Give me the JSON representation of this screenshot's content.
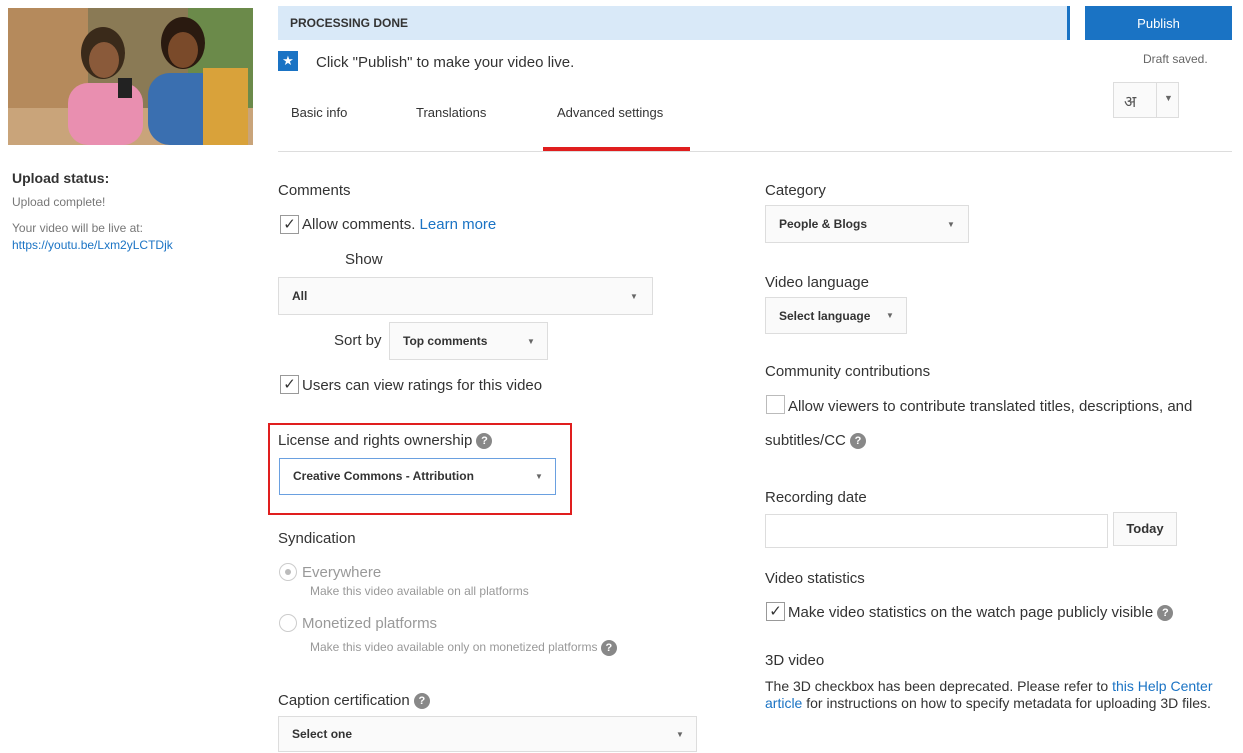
{
  "sidebar": {
    "status_title": "Upload status:",
    "status_text": "Upload complete!",
    "live_text": "Your video will be live at:",
    "video_link": "https://youtu.be/Lxm2yLCTDjk"
  },
  "header": {
    "processing": "PROCESSING DONE",
    "publish_label": "Publish",
    "draft_saved": "Draft saved.",
    "publish_hint": "Click \"Publish\" to make your video live.",
    "lang_glyph": "अ"
  },
  "tabs": [
    {
      "label": "Basic info"
    },
    {
      "label": "Translations"
    },
    {
      "label": "Advanced settings",
      "active": true
    }
  ],
  "comments": {
    "heading": "Comments",
    "allow_label": "Allow comments.",
    "learn_more": "Learn more",
    "show_label": "Show",
    "show_value": "All",
    "sort_label": "Sort by",
    "sort_value": "Top comments",
    "ratings_label": "Users can view ratings for this video"
  },
  "license": {
    "heading": "License and rights ownership",
    "value": "Creative Commons - Attribution"
  },
  "syndication": {
    "heading": "Syndication",
    "everywhere": "Everywhere",
    "everywhere_desc": "Make this video available on all platforms",
    "monetized": "Monetized platforms",
    "monetized_desc": "Make this video available only on monetized platforms"
  },
  "caption": {
    "heading": "Caption certification",
    "value": "Select one"
  },
  "category": {
    "heading": "Category",
    "value": "People & Blogs"
  },
  "video_language": {
    "heading": "Video language",
    "value": "Select language"
  },
  "community": {
    "heading": "Community contributions",
    "label_line1": "Allow viewers to contribute translated titles, descriptions, and",
    "label_line2": "subtitles/CC"
  },
  "recording": {
    "heading": "Recording date",
    "value": "",
    "today_label": "Today"
  },
  "statistics": {
    "heading": "Video statistics",
    "label": "Make video statistics on the watch page publicly visible"
  },
  "video3d": {
    "heading": "3D video",
    "text_before": "The 3D checkbox has been deprecated. Please refer to ",
    "link_text": "this Help Center article",
    "text_after": " for instructions on how to specify metadata for uploading 3D files."
  },
  "icons": {
    "help": "?",
    "star": "★",
    "check": "✓",
    "caret": "▼"
  },
  "colors": {
    "accent": "#1a73c4",
    "highlight": "#e01e1e",
    "processing_bg": "#d9e9f8"
  }
}
